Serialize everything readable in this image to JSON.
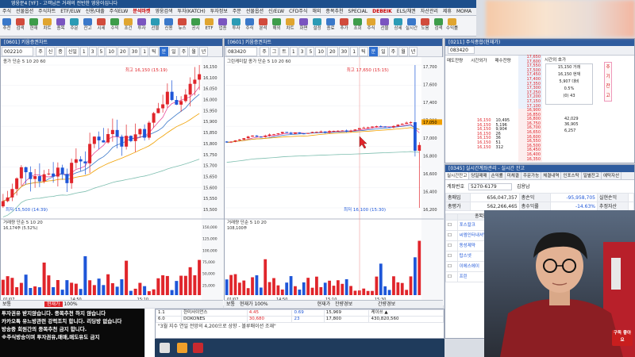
{
  "app": {
    "title": "영웅문4 [YF] - 고객님은 거래의 전반한 영웅이십니다",
    "menu": [
      "주식",
      "선물옵션",
      "주식차트",
      "ETF/ELW",
      "신용/대출",
      "주식ELW",
      "분석마켓",
      "영웅검색",
      "투자(KATCH)",
      "투자정보",
      "주문",
      "선물옵션",
      "신/ELW",
      "CFD주식",
      "해외",
      "종목추천",
      "SPECIAL",
      "DEBEIK",
      "ELS/채권",
      "자산관리",
      "제휴",
      "MOMA",
      "온라인업무",
      "고객서비스",
      "도움말"
    ],
    "menu_highlight": [
      "분석마켓",
      "DEBEIK"
    ],
    "toolbar": [
      "추천",
      "검색",
      "현재",
      "차트",
      "종목",
      "주문",
      "잔고",
      "시세",
      "수익",
      "조건",
      "투자",
      "선물",
      "신용",
      "뉴스",
      "공시",
      "ETF",
      "업종",
      "투자",
      "주식",
      "분석",
      "해외",
      "차트",
      "화면",
      "설정",
      "종료",
      "추가",
      "조회",
      "주식",
      "선물",
      "상세",
      "실시간",
      "도움",
      "검색",
      "수익률"
    ]
  },
  "chart_left": {
    "title": "[0601] 키움증권차트",
    "code": "002210",
    "tabs": [
      "주",
      "신",
      "종",
      "신일",
      "1",
      "3",
      "5",
      "10",
      "20",
      "30",
      "1",
      "틱",
      "분",
      "일",
      "주",
      "월",
      "년"
    ],
    "price_label": "종가 단순 5 10 20 60",
    "high_label": "최고 16,150 (15:19)",
    "low_label": "최저 15,500 (14:39)",
    "vol_label": "거래량 단순 5 10 20",
    "vol_value": "16,174주 (5.52%)",
    "y_ticks": [
      "16,150",
      "16,100",
      "16,050",
      "16,000",
      "15,950",
      "15,900",
      "15,850",
      "15,800",
      "15,750",
      "15,700",
      "15,650",
      "15,600",
      "15,550",
      "15,500"
    ],
    "vol_ticks": [
      "150,000",
      "125,000",
      "100,000",
      "75,000",
      "50,000",
      "25,000"
    ],
    "x_labels": [
      "01/07",
      "14:50",
      "15:10"
    ]
  },
  "chart_right": {
    "title": "[0601] 키움증권차트",
    "code": "083420",
    "tabs": [
      "주",
      "그",
      "트",
      "1",
      "3",
      "5",
      "10",
      "20",
      "30",
      "1",
      "틱",
      "분",
      "일",
      "주",
      "월",
      "년"
    ],
    "price_label": "그린케미칼 종가 단순 5 10 20 60",
    "high_label": "최고 17,650 (15:15)",
    "low_label": "최저 16,100 (15:30)",
    "vol_label": "거래량 단순 5 10 20",
    "vol_value": "108,100주",
    "y_ticks": [
      "17,700",
      "17,600",
      "17,400",
      "17,200",
      "17,000",
      "16,800",
      "16,600",
      "16,400",
      "16,200"
    ],
    "current_tag": "17,050",
    "x_labels": [
      "01/07",
      "14:50",
      "15:10",
      "15:30"
    ]
  },
  "orderbook": {
    "title": "[0211] 주식종합(현재가)",
    "code": "083420",
    "header": [
      "매도잔량",
      "시간외가",
      "매수잔량"
    ],
    "center_title": "시간외 호가",
    "center_box": [
      "15,150 거래",
      "16,150 현재",
      "5,907 대비",
      "0.5%",
      "(0) 43"
    ],
    "sell_prices": [
      "17,650",
      "17,600",
      "17,550",
      "17,500",
      "17,450",
      "17,400",
      "17,350",
      "17,300",
      "17,250",
      "17,200",
      "17,150",
      "17,100"
    ],
    "buy_prices": [
      "16,900",
      "16,850",
      "16,800",
      "16,750",
      "16,700",
      "16,650",
      "16,600",
      "16,550",
      "16,500",
      "16,450",
      "16,400",
      "16,350"
    ],
    "lower_left": [
      [
        "16,150",
        "10,495"
      ],
      [
        "16,150",
        "5,196"
      ],
      [
        "16,150",
        "9,904"
      ],
      [
        "16,150",
        "26"
      ],
      [
        "16,150",
        "36"
      ],
      [
        "16,150",
        "51"
      ],
      [
        "16,150",
        "312"
      ]
    ],
    "lower_right": [
      [
        "42,029"
      ],
      [
        "36,905"
      ],
      [
        "6,257"
      ]
    ],
    "side_vertical": [
      "주",
      "기",
      "잔",
      "고"
    ]
  },
  "account": {
    "title": "[0345] 실시간계좌관리 - 실시간 잔고",
    "tabs": [
      "실시간잔고",
      "당일매매",
      "손익률",
      "미체결",
      "주문가능",
      "체결내역",
      "인포스탁",
      "일별잔고",
      "예탁자산"
    ],
    "account_label": "계좌번호",
    "account_no": "5270-6179",
    "owner": "김용남",
    "summary": [
      {
        "label": "총매입",
        "value": "656,047,357",
        "label2": "총손익",
        "value2": "-95,958,705",
        "label3": "실현손익"
      },
      {
        "label": "총평가",
        "value": "562,266,465",
        "label2": "총수익률",
        "value2": "-14.63%",
        "label3": "추정자산"
      }
    ],
    "columns": [
      "",
      "종목명",
      "평가손익",
      "",
      "수익률",
      "",
      "",
      "보유수량",
      "가능수량"
    ],
    "rows": [
      {
        "name": "포스칼크",
        "pnl": "",
        "rate": "",
        "hold": "",
        "avail": ""
      },
      {
        "name": "씨엠인터내셔널",
        "pnl": "",
        "rate": "",
        "hold": "",
        "avail": ""
      },
      {
        "name": "동성제약",
        "pnl": "",
        "rate": "",
        "hold": "1",
        "avail": "1.5"
      },
      {
        "name": "탑스넷",
        "pnl": "",
        "rate": "",
        "hold": "",
        "avail": ""
      },
      {
        "name": "이에스에이",
        "pnl": "",
        "rate": "",
        "hold": "",
        "avail": ""
      },
      {
        "name": "프린",
        "pnl": "",
        "rate": "",
        "hold": "",
        "avail": ""
      }
    ]
  },
  "news": {
    "lines": [
      "투자권유 받지않습니다. 종목추천 하지 않습니다",
      "카카오톡 유느방관련 강력조치 합니다. 리딩방 없습니다",
      "방송중 회원간의 종목추천 금지 합니다.",
      "※주식방송이며 투자권유,매매,매도유도 금지"
    ]
  },
  "bottom": {
    "left_label": "보통",
    "left_items": [
      "현재가",
      "100%"
    ],
    "mid_items": [
      "보통",
      "현재가",
      "100%"
    ],
    "right_items": [
      "현재가",
      "잔량경보"
    ],
    "far_right": "간량경보"
  },
  "ticker": {
    "rows": [
      [
        "1.1",
        "한미사이언스",
        "4.45",
        "0.69",
        "15,969",
        "케이쓰 ▲"
      ],
      [
        "6.0",
        "DOKONES",
        "30,680",
        "23",
        "17,800",
        "430,820,560"
      ]
    ],
    "notice": "\"3월 지수 연일 전망의 4,200으로 상향 - 볼루매이션 조재\""
  },
  "webcam_badge": "구독 좋아요"
}
